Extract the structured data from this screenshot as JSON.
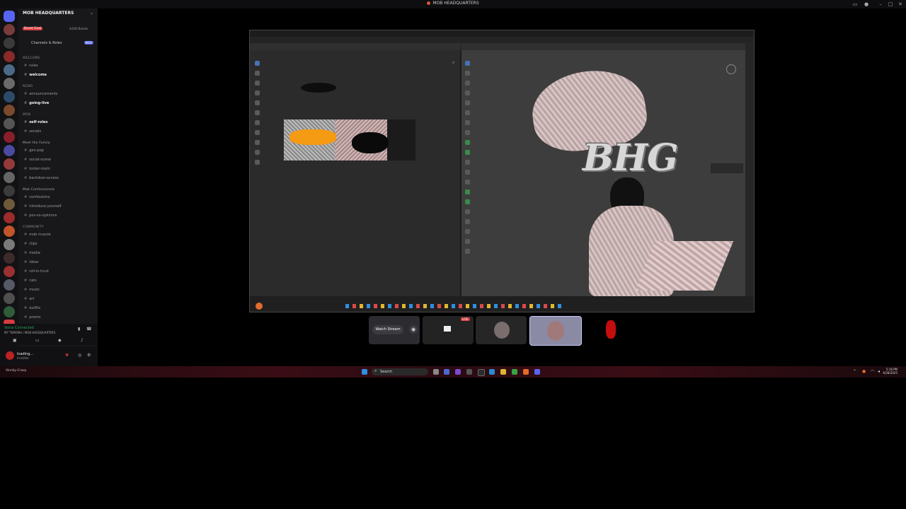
{
  "window": {
    "title": "MOB HEADQUARTERS"
  },
  "server": {
    "name": "MOB HEADQUARTERS"
  },
  "top": {
    "boost_badge": "Boost Goal",
    "boosts": "4/200 Boosts",
    "channels_roles": "Channels & Roles",
    "new_pill": "NEW"
  },
  "categories": {
    "welcome": "WELCOME",
    "news": "NEWS",
    "mob": "MOB",
    "meet": "Meet the Family",
    "confessionals": "Mob Confessionals",
    "community": "COMMUNITY"
  },
  "channels": {
    "rules": "rules",
    "welcome": "welcome",
    "announcements": "announcements",
    "going_live": "going-live",
    "self_roles": "self-roles",
    "socials": "socials",
    "gen_pop": "gen-pop",
    "social_scene": "social-scene",
    "locker_room": "locker-room",
    "backdoor_access": "backdoor-access",
    "confessions": "confessions",
    "introduce_yourself": "introduce-yourself",
    "pov_opinions": "pov-vs-opinions",
    "mob_muscle": "mob muscle",
    "clips": "clips",
    "media": "media",
    "ideas": "ideas",
    "roll_in": "roll-in-trust",
    "cats": "cats",
    "music": "music",
    "art": "art",
    "outfits": "outfits",
    "promo": "promo"
  },
  "voice": {
    "status": "Voice Connected",
    "location": "MY TEMOMA / MOB HEADQUARTERS"
  },
  "user": {
    "name": "loading...",
    "status": "Invisible"
  },
  "streamer": {
    "name": "Vinnily-Crazy"
  },
  "viewport": {
    "logo_text": "BHG"
  },
  "stream": {
    "watch_label": "Watch Stream",
    "live_badge": "LIVE"
  },
  "taskbar": {
    "search": "Search",
    "time": "5:18 PM",
    "date": "6/28/2025"
  },
  "colors": {
    "accent": "#5865f2",
    "danger": "#d83c3e",
    "orange_paint": "#f59a13",
    "voice_green": "#23a55a"
  }
}
